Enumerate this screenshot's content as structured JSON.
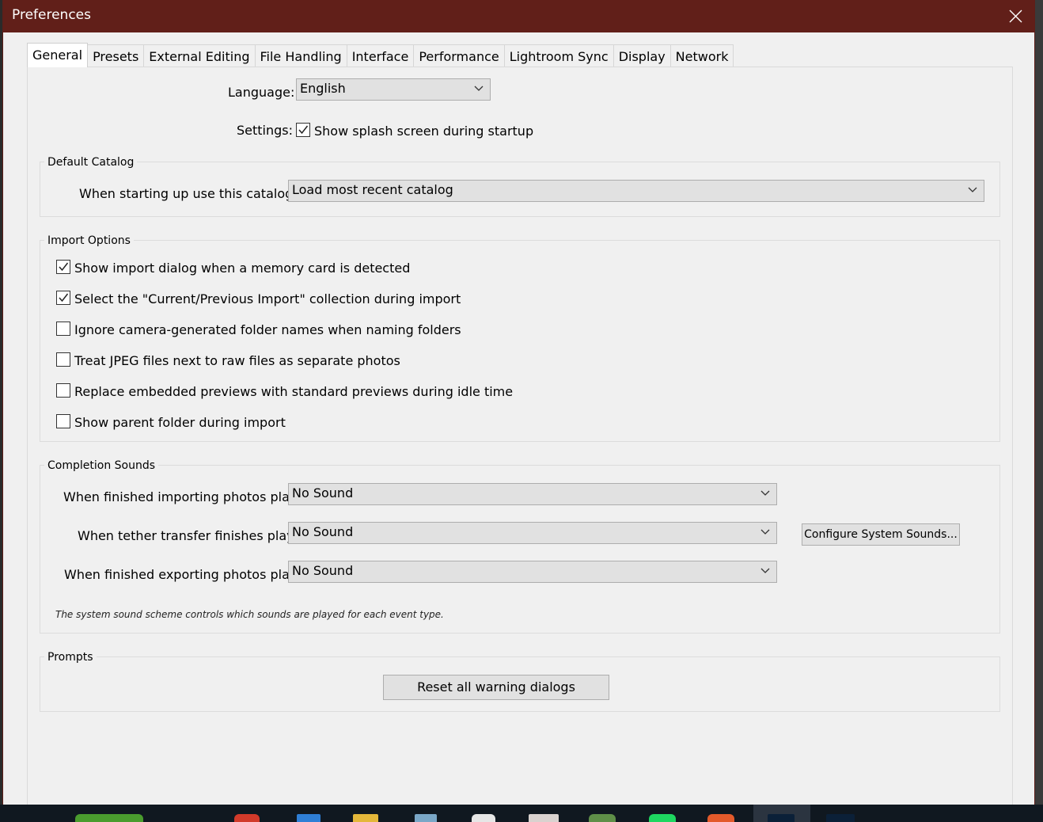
{
  "window": {
    "title": "Preferences"
  },
  "tabs": [
    {
      "label": "General",
      "active": true
    },
    {
      "label": "Presets"
    },
    {
      "label": "External Editing"
    },
    {
      "label": "File Handling"
    },
    {
      "label": "Interface"
    },
    {
      "label": "Performance"
    },
    {
      "label": "Lightroom Sync"
    },
    {
      "label": "Display"
    },
    {
      "label": "Network"
    }
  ],
  "general": {
    "language_label": "Language:",
    "language_value": "English",
    "settings_label": "Settings:",
    "splash_label": "Show splash screen during startup",
    "splash_checked": true
  },
  "default_catalog": {
    "title": "Default Catalog",
    "label": "When starting up use this catalog:",
    "value": "Load most recent catalog"
  },
  "import_options": {
    "title": "Import Options",
    "items": [
      {
        "label": "Show import dialog when a memory card is detected",
        "checked": true
      },
      {
        "label": "Select the \"Current/Previous Import\" collection during import",
        "checked": true
      },
      {
        "label": "Ignore camera-generated folder names when naming folders",
        "checked": false
      },
      {
        "label": "Treat JPEG files next to raw files as separate photos",
        "checked": false
      },
      {
        "label": "Replace embedded previews with standard previews during idle time",
        "checked": false
      },
      {
        "label": "Show parent folder during import",
        "checked": false
      }
    ]
  },
  "completion_sounds": {
    "title": "Completion Sounds",
    "import_label": "When finished importing photos play:",
    "import_value": "No Sound",
    "tether_label": "When tether transfer finishes play:",
    "tether_value": "No Sound",
    "export_label": "When finished exporting photos play:",
    "export_value": "No Sound",
    "configure_button": "Configure System Sounds...",
    "note": "The system sound scheme controls which sounds are played for each event type."
  },
  "prompts": {
    "title": "Prompts",
    "reset_button": "Reset all warning dialogs"
  },
  "colors": {
    "titlebar": "#611f19",
    "dialog_bg": "#f0f0f0",
    "control_bg": "#e1e1e1"
  }
}
